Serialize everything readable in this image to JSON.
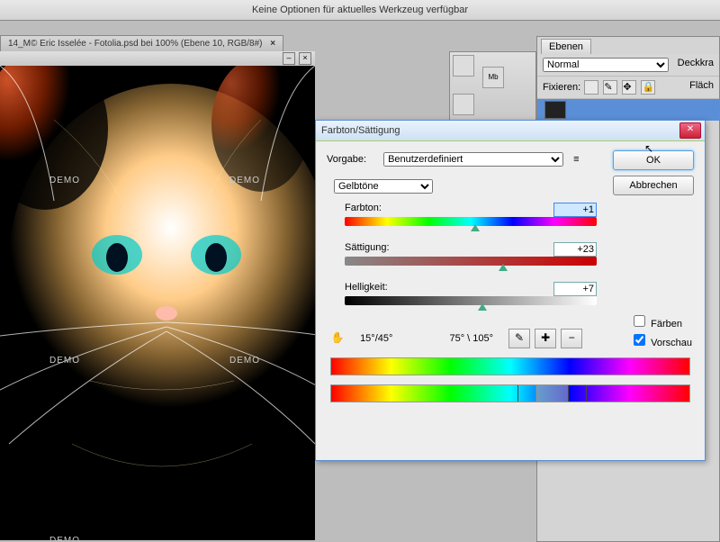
{
  "optbar": "Keine Optionen für aktuelles Werkzeug verfügbar",
  "doctab": "14_M© Eric Isselée - Fotolia.psd bei 100% (Ebene 10, RGB/8#)",
  "wm": "DEMO",
  "layers": {
    "tab": "Ebenen",
    "blend": "Normal",
    "opacityLabel": "Deckkra",
    "fixlabel": "Fixieren:",
    "filllabel": "Fläch"
  },
  "dialog": {
    "title": "Farbton/Sättigung",
    "ok": "OK",
    "cancel": "Abbrechen",
    "presetLabel": "Vorgabe:",
    "preset": "Benutzerdefiniert",
    "channel": "Gelbtöne",
    "hueLabel": "Farbton:",
    "hue": "+1",
    "satLabel": "Sättigung:",
    "sat": "+23",
    "ligLabel": "Helligkeit:",
    "lig": "+7",
    "range1": "15°/45°",
    "range2": "75° \\ 105°",
    "colorize": "Färben",
    "preview": "Vorschau"
  }
}
